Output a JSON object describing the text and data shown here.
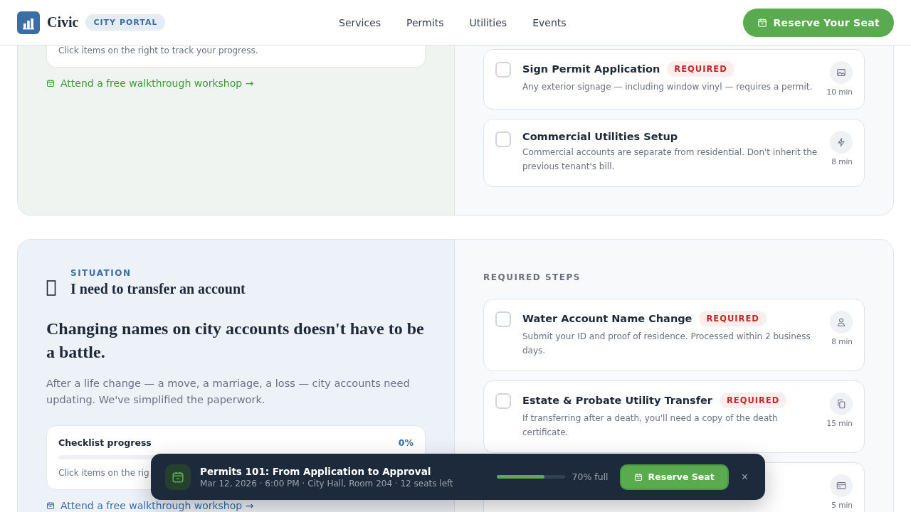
{
  "header": {
    "brand": "Civic",
    "badge": "CITY PORTAL",
    "nav": [
      {
        "label": "Services"
      },
      {
        "label": "Permits"
      },
      {
        "label": "Utilities"
      },
      {
        "label": "Events"
      }
    ],
    "cta": "Reserve Your Seat"
  },
  "sections": [
    {
      "color": "#3f9a3a",
      "progress_hint": "Click items on the right to track your progress.",
      "link": "Attend a free walkthrough workshop →",
      "steps": [
        {
          "title": "Sign Permit Application",
          "required": true,
          "badge": "REQUIRED",
          "description": "Any exterior signage — including window vinyl — requires a permit.",
          "kind": "image",
          "duration": "10 min",
          "checked": false
        },
        {
          "title": "Commercial Utilities Setup",
          "required": false,
          "description": "Commercial accounts are separate from residential. Don't inherit the previous tenant's bill.",
          "kind": "bolt",
          "duration": "8 min",
          "checked": false
        }
      ]
    },
    {
      "color": "#3b6ea5",
      "eyebrow": "SITUATION",
      "situation": "I need to transfer an account",
      "heading": "Changing names on city accounts doesn't have to be a battle.",
      "intro": "After a life change — a move, a marriage, a loss — city accounts need updating. We've simplified the paperwork.",
      "progress_label": "Checklist progress",
      "progress_value": "0%",
      "level": 0,
      "progress_hint": "Click items on the rig",
      "link": "Attend a free walkthrough workshop →",
      "steps_title": "REQUIRED STEPS",
      "steps": [
        {
          "title": "Water Account Name Change",
          "required": true,
          "badge": "REQUIRED",
          "description": "Submit your ID and proof of residence. Processed within 2 business days.",
          "kind": "person",
          "duration": "8 min",
          "checked": false
        },
        {
          "title": "Estate & Probate Utility Transfer",
          "required": true,
          "badge": "REQUIRED",
          "description": "If transferring after a death, you'll need a copy of the death certificate.",
          "kind": "copy",
          "duration": "15 min",
          "checked": false
        },
        {
          "kind": "card",
          "duration": "5 min"
        }
      ]
    }
  ],
  "toast": {
    "title": "Permits 101: From Application to Approval",
    "details": "Mar 12, 2026 · 6:00 PM · City Hall, Room 204 · 12 seats left",
    "level": 0.7,
    "fill_text": "70% full",
    "button": "Reserve Seat",
    "close": "×"
  }
}
